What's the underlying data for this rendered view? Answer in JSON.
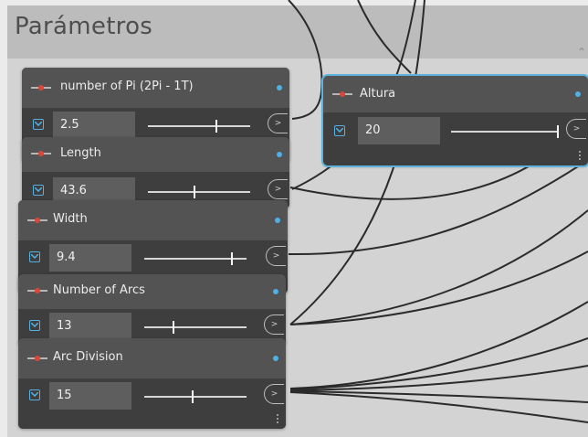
{
  "group": {
    "title": "Parámetros"
  },
  "nodes": [
    {
      "id": "pi",
      "title": "number of Pi (2Pi - 1T)",
      "value": "2.5",
      "slider_fraction": 0.66,
      "selected": false
    },
    {
      "id": "length",
      "title": "Length",
      "value": "43.6",
      "slider_fraction": 0.45,
      "selected": false
    },
    {
      "id": "width",
      "title": "Width",
      "value": "9.4",
      "slider_fraction": 0.85,
      "selected": false
    },
    {
      "id": "arcs",
      "title": "Number of Arcs",
      "value": "13",
      "slider_fraction": 0.28,
      "selected": false
    },
    {
      "id": "division",
      "title": "Arc Division",
      "value": "15",
      "slider_fraction": 0.46,
      "selected": false
    },
    {
      "id": "altura",
      "title": "Altura",
      "value": "20",
      "slider_fraction": 1.0,
      "selected": true
    }
  ],
  "ui": {
    "output_port_glyph": ">",
    "icons": {
      "node_icon": "number-slider-icon",
      "expand": "expand-toggle-icon",
      "more": "more-options-icon",
      "collapse": "chevron-up-icon"
    },
    "colors": {
      "group_header": "#bcbcbc",
      "group_body": "#d3d3d3",
      "node_header": "#535353",
      "node_body": "#3e3e3e",
      "accent": "#5bb2dc",
      "status_dot": "#4fb0e6",
      "wire": "#2b2b2b"
    }
  }
}
